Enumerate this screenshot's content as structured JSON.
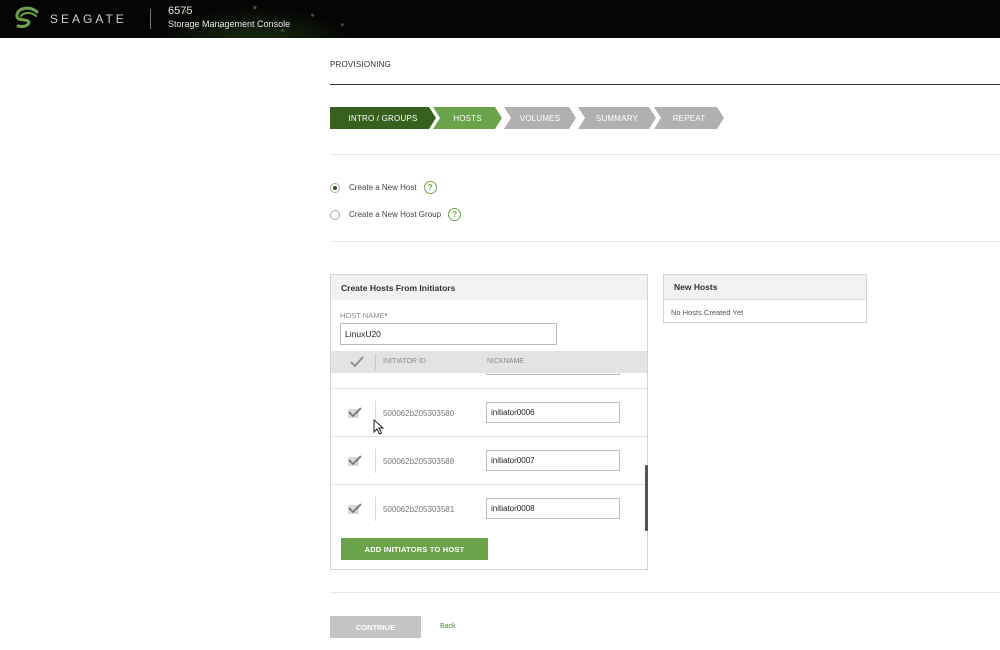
{
  "header": {
    "brand": "SEAGATE",
    "model": "6575",
    "console_title": "Storage Management Console"
  },
  "page": {
    "title": "PROVISIONING"
  },
  "wizard": {
    "steps": [
      {
        "label": "INTRO / GROUPS",
        "state": "completed"
      },
      {
        "label": "HOSTS",
        "state": "active"
      },
      {
        "label": "VOLUMES",
        "state": "pending"
      },
      {
        "label": "SUMMARY",
        "state": "pending"
      },
      {
        "label": "REPEAT",
        "state": "pending"
      }
    ]
  },
  "options": [
    {
      "label": "Create a New Host",
      "selected": true
    },
    {
      "label": "Create a New Host Group",
      "selected": false
    }
  ],
  "create_panel": {
    "title": "Create Hosts From Initiators",
    "host_name_label": "HOST NAME",
    "required_mark": "*",
    "host_name_value": "LinuxU20",
    "columns": {
      "id": "INITIATOR ID",
      "nickname": "NICKNAME"
    },
    "rows": [
      {
        "initiator_id": "500062b205303580",
        "nickname": "initiator0006",
        "checked": true
      },
      {
        "initiator_id": "500062b205303588",
        "nickname": "initiator0007",
        "checked": true
      },
      {
        "initiator_id": "500062b205303581",
        "nickname": "initiator0008",
        "checked": true
      }
    ],
    "add_button": "ADD INITIATORS TO HOST"
  },
  "new_hosts_panel": {
    "title": "New Hosts",
    "empty_text": "No Hosts Created Yet"
  },
  "footer": {
    "continue_label": "CONTINUE",
    "back_label": "Back"
  },
  "colors": {
    "header_bg": "#050505",
    "brand_green": "#6ba34a",
    "dark_green": "#37611f",
    "pending_gray": "#b0b0b0"
  }
}
